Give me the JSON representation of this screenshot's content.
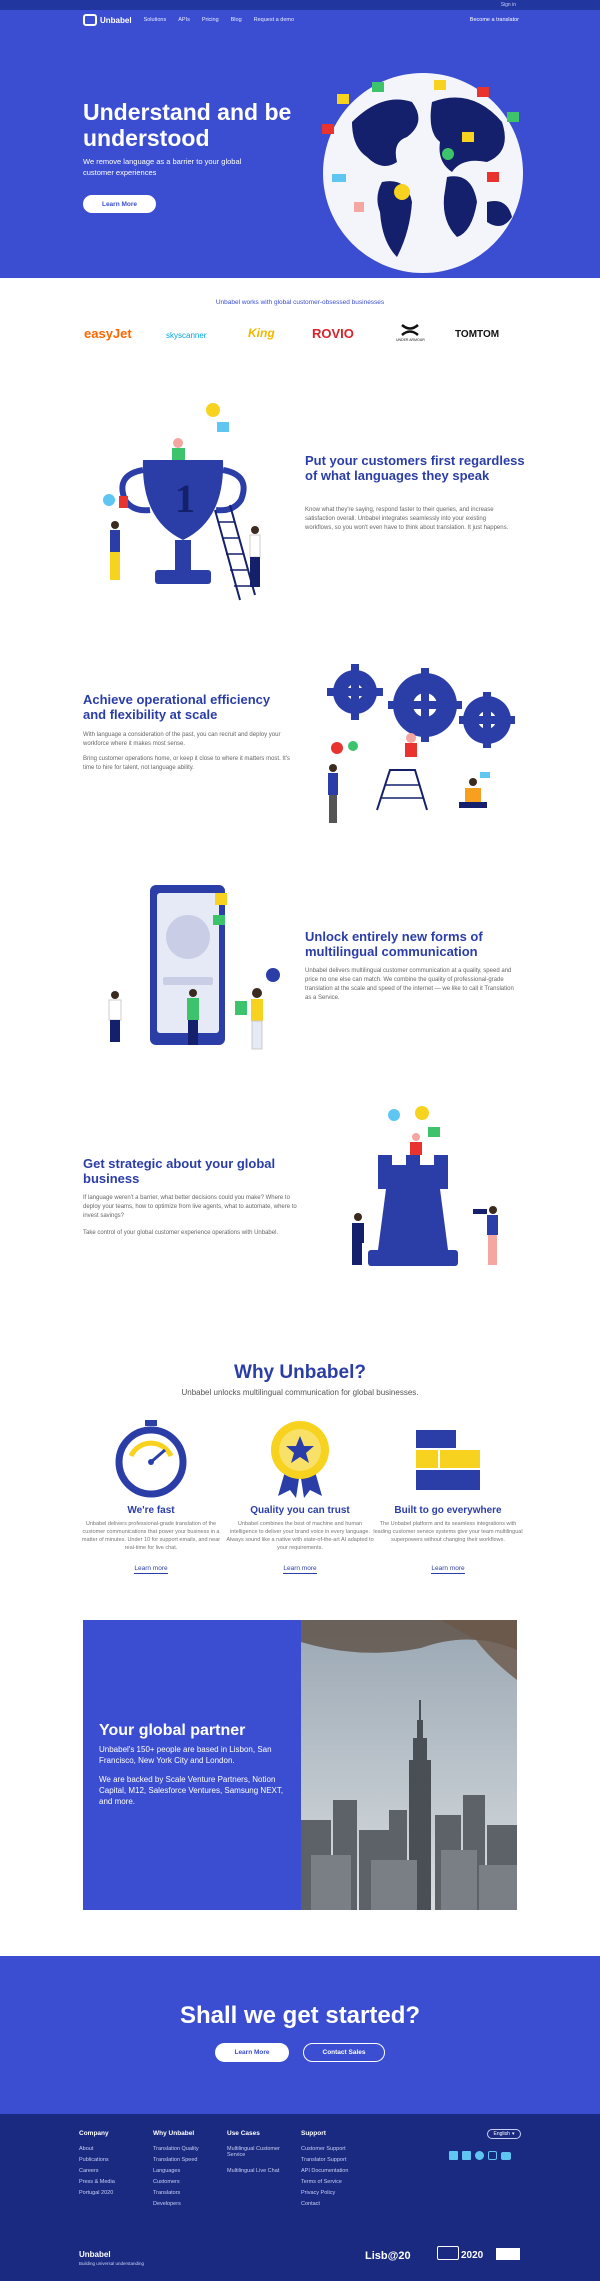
{
  "topbar": {
    "signin": "Sign in"
  },
  "nav": {
    "brand": "Unbabel",
    "links": [
      "Solutions",
      "APIs",
      "Pricing",
      "Blog",
      "Request a demo"
    ],
    "right_link": "Become a translator"
  },
  "hero": {
    "title": "Understand and be understood",
    "subtitle": "We remove language as a barrier to your global customer experiences",
    "cta": "Learn More"
  },
  "logos": {
    "title": "Unbabel works with global customer-obsessed businesses",
    "brands": [
      "easyJet",
      "skyscanner",
      "King",
      "ROVIO",
      "UNDER ARMOUR",
      "TOMTOM"
    ]
  },
  "sections": [
    {
      "title": "Put your customers first regardless of what languages they speak",
      "text": "Know what they're saying, respond faster to their queries, and increase satisfaction overall. Unbabel integrates seamlessly into your existing workflows, so you won't even have to think about translation. It just happens."
    },
    {
      "title": "Achieve operational efficiency and flexibility at scale",
      "text": "With language a consideration of the past, you can recruit and deploy your workforce where it makes most sense.",
      "text2": "Bring customer operations home, or keep it close to where it matters most. It's time to hire for talent, not language ability."
    },
    {
      "title": "Unlock entirely new forms of multilingual communication",
      "text": "Unbabel delivers multilingual customer communication at a quality, speed and price no one else can match. We combine the quality of professional-grade translation at the scale and speed of the internet — we like to call it Translation as a Service."
    },
    {
      "title": "Get strategic about your global business",
      "text": "If language weren't a barrier, what better decisions could you make? Where to deploy your teams, how to optimize from live agents, what to automate, where to invest savings?",
      "text2": "Take control of your global customer experience operations with Unbabel."
    }
  ],
  "why": {
    "title": "Why Unbabel?",
    "subtitle": "Unbabel unlocks multilingual communication for global businesses.",
    "cards": [
      {
        "title": "We're fast",
        "text": "Unbabel delivers professional-grade translation of the customer communications that power your business in a matter of minutes. Under 10 for support emails, and near real-time for live chat.",
        "link": "Learn more"
      },
      {
        "title": "Quality you can trust",
        "text": "Unbabel combines the best of machine and human intelligence to deliver your brand voice in every language. Always sound like a native with state-of-the-art AI adapted to your requirements.",
        "link": "Learn more"
      },
      {
        "title": "Built to go everywhere",
        "text": "The Unbabel platform and its seamless integrations with leading customer service systems give your team multilingual superpowers without changing their workflows.",
        "link": "Learn more"
      }
    ]
  },
  "partner": {
    "title": "Your global partner",
    "text1": "Unbabel's 150+ people are based in Lisbon, San Francisco, New York City and London.",
    "text2": "We are backed by Scale Venture Partners, Notion Capital, M12, Salesforce Ventures, Samsung NEXT, and more."
  },
  "cta": {
    "title": "Shall we get started?",
    "primary": "Learn More",
    "secondary": "Contact Sales"
  },
  "footer": {
    "columns": [
      {
        "title": "Company",
        "links": [
          "About",
          "Publications",
          "Careers",
          "Press & Media",
          "Portugal 2020"
        ]
      },
      {
        "title": "Why Unbabel",
        "links": [
          "Translation Quality",
          "Translation Speed",
          "Languages",
          "Customers",
          "Translators",
          "Developers"
        ]
      },
      {
        "title": "Use Cases",
        "links": [
          "Multilingual Customer Service",
          "Multilingual Live Chat"
        ]
      },
      {
        "title": "Support",
        "links": [
          "Customer Support",
          "Translator Support",
          "API Documentation",
          "Terms of Service",
          "Privacy Policy",
          "Contact"
        ]
      }
    ],
    "language": "English",
    "brand": "Unbabel",
    "tagline": "Building universal understanding",
    "badges": [
      "Lisb@20",
      "2020"
    ]
  },
  "colors": {
    "primary": "#3b4ed1",
    "footer": "#1a2a80",
    "accent_yellow": "#f7d21e",
    "accent_red": "#e8332f",
    "accent_green": "#3cc36b"
  }
}
